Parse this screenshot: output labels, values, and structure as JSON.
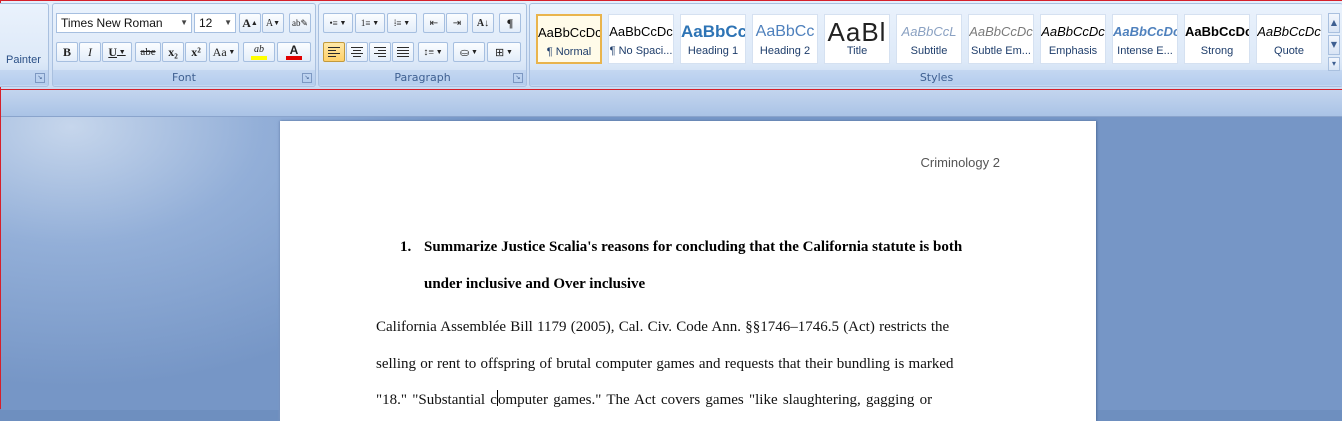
{
  "clipboard": {
    "painter_label": "Painter"
  },
  "font": {
    "group_label": "Font",
    "font_name": "Times New Roman",
    "font_size": "12",
    "grow_label": "A",
    "shrink_label": "A",
    "bold_label": "B",
    "italic_label": "I",
    "underline_label": "U",
    "strike_label": "abe",
    "subscript_label": "x₂",
    "superscript_label": "x²",
    "case_label": "Aa",
    "highlight_label": "ab",
    "font_color_label": "A",
    "highlight_color": "#ffff00",
    "font_color": "#e00000"
  },
  "paragraph": {
    "group_label": "Paragraph",
    "pilcrow": "¶"
  },
  "styles": {
    "group_label": "Styles",
    "items": [
      {
        "sample": "AaBbCcDc",
        "name": "¶ Normal"
      },
      {
        "sample": "AaBbCcDc",
        "name": "¶ No Spaci..."
      },
      {
        "sample": "AaBbCc",
        "name": "Heading 1"
      },
      {
        "sample": "AaBbCc",
        "name": "Heading 2"
      },
      {
        "sample": "AaBl",
        "name": "Title"
      },
      {
        "sample": "AaBbCcL",
        "name": "Subtitle"
      },
      {
        "sample": "AaBbCcDc",
        "name": "Subtle Em..."
      },
      {
        "sample": "AaBbCcDc",
        "name": "Emphasis"
      },
      {
        "sample": "AaBbCcDc",
        "name": "Intense E..."
      },
      {
        "sample": "AaBbCcDc",
        "name": "Strong"
      },
      {
        "sample": "AaBbCcDc",
        "name": "Quote"
      }
    ],
    "selected": "¶ Normal"
  },
  "document": {
    "header": "Criminology 2",
    "heading_number": "1.",
    "heading_line1": "Summarize Justice Scalia's reasons for concluding that the California statute is both",
    "heading_line2": "under inclusive  and Over inclusive",
    "body_lines": [
      "California Assemblée Bill 1179 (2005), Cal. Civ. Code Ann. §§1746–1746.5 (Act) restricts the",
      "selling  or rent to offspring of brutal computer games and requests that their bundling is marked",
      "\"18.\" \"Substantial computer games.\" The Act covers games \"like slaughtering, gagging or"
    ],
    "line3_before_caret": "\"18.\" \"Substantial c",
    "line3_after_caret": "omputer games.\" The Act covers games \"like slaughtering, gagging or"
  }
}
